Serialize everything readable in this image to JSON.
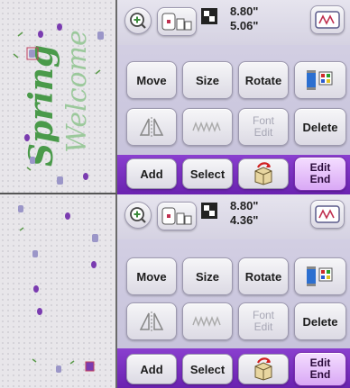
{
  "panels": [
    {
      "dimensions": {
        "width": "8.80\"",
        "height": "5.06\""
      },
      "buttons": {
        "move": "Move",
        "size": "Size",
        "rotate": "Rotate",
        "font_edit": "Font\nEdit",
        "delete": "Delete",
        "add": "Add",
        "select": "Select",
        "edit_end": "Edit\nEnd"
      },
      "preview_text": "Welcome Spring"
    },
    {
      "dimensions": {
        "width": "8.80\"",
        "height": "4.36\""
      },
      "buttons": {
        "move": "Move",
        "size": "Size",
        "rotate": "Rotate",
        "font_edit": "Font\nEdit",
        "delete": "Delete",
        "add": "Add",
        "select": "Select",
        "edit_end": "Edit\nEnd"
      }
    }
  ],
  "colors": {
    "accent": "#7a2fc4",
    "button": "#eeeeee",
    "thread": "#5a9a4a"
  },
  "icons": [
    "zoom-in-icon",
    "hoop-size-icon",
    "pattern-size-icon",
    "embroidery-frame-icon",
    "thread-color-icon",
    "mirror-icon",
    "density-icon",
    "undo-rotate-icon"
  ]
}
